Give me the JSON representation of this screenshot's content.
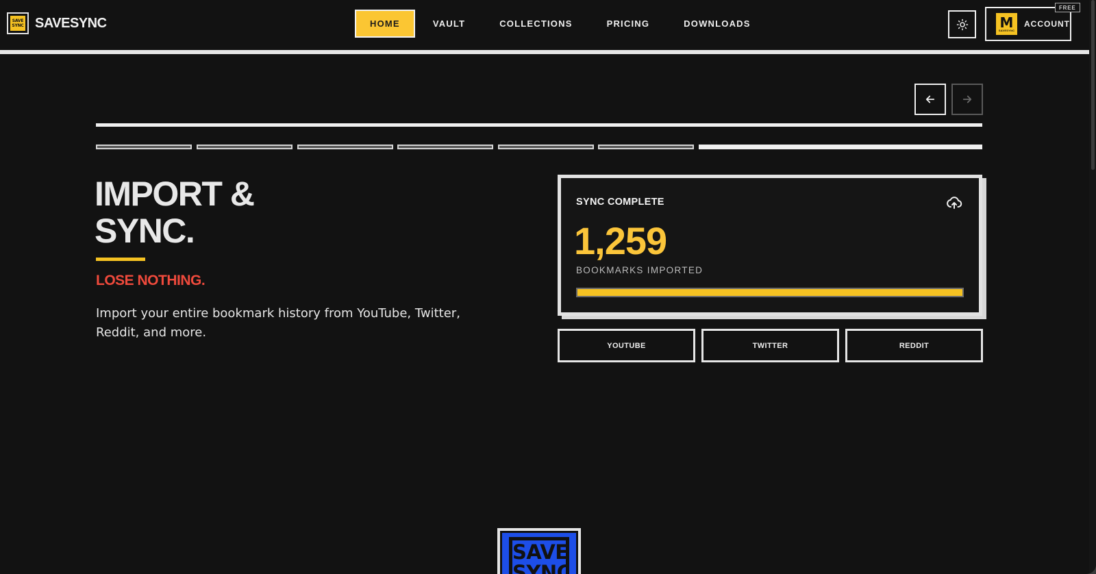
{
  "brand": {
    "logo_line1": "SAVE",
    "logo_line2": "SYNC",
    "name": "SAVESYNC"
  },
  "nav": {
    "items": [
      {
        "label": "HOME",
        "active": true
      },
      {
        "label": "VAULT",
        "active": false
      },
      {
        "label": "COLLECTIONS",
        "active": false
      },
      {
        "label": "PRICING",
        "active": false
      },
      {
        "label": "DOWNLOADS",
        "active": false
      }
    ]
  },
  "header_actions": {
    "theme_icon": "sun-icon",
    "account_label": "ACCOUNT",
    "account_avatar_letter": "M",
    "account_avatar_sub": "SAVESYNC",
    "plan_badge": "FREE"
  },
  "slider": {
    "prev_icon": "arrow-left-icon",
    "next_icon": "arrow-right-icon",
    "total_slides": 7,
    "current_slide": 7
  },
  "hero": {
    "title": "IMPORT &\nSYNC.",
    "tagline": "LOSE NOTHING.",
    "description": "Import your entire bookmark history from YouTube, Twitter, Reddit, and more."
  },
  "sync_card": {
    "title": "SYNC COMPLETE",
    "icon": "cloud-upload-icon",
    "count": "1,259",
    "subtitle": "BOOKMARKS IMPORTED",
    "progress": 1.0
  },
  "sources": [
    {
      "label": "YOUTUBE"
    },
    {
      "label": "TWITTER"
    },
    {
      "label": "REDDIT"
    }
  ],
  "footer_logo": {
    "line1": "SAVE",
    "line2": "SYNC"
  },
  "colors": {
    "background": "#121212",
    "accent_yellow": "#f5c222",
    "accent_red": "#ef4a3c",
    "footer_blue": "#1d4ee8",
    "foreground": "#f0f0f0"
  }
}
